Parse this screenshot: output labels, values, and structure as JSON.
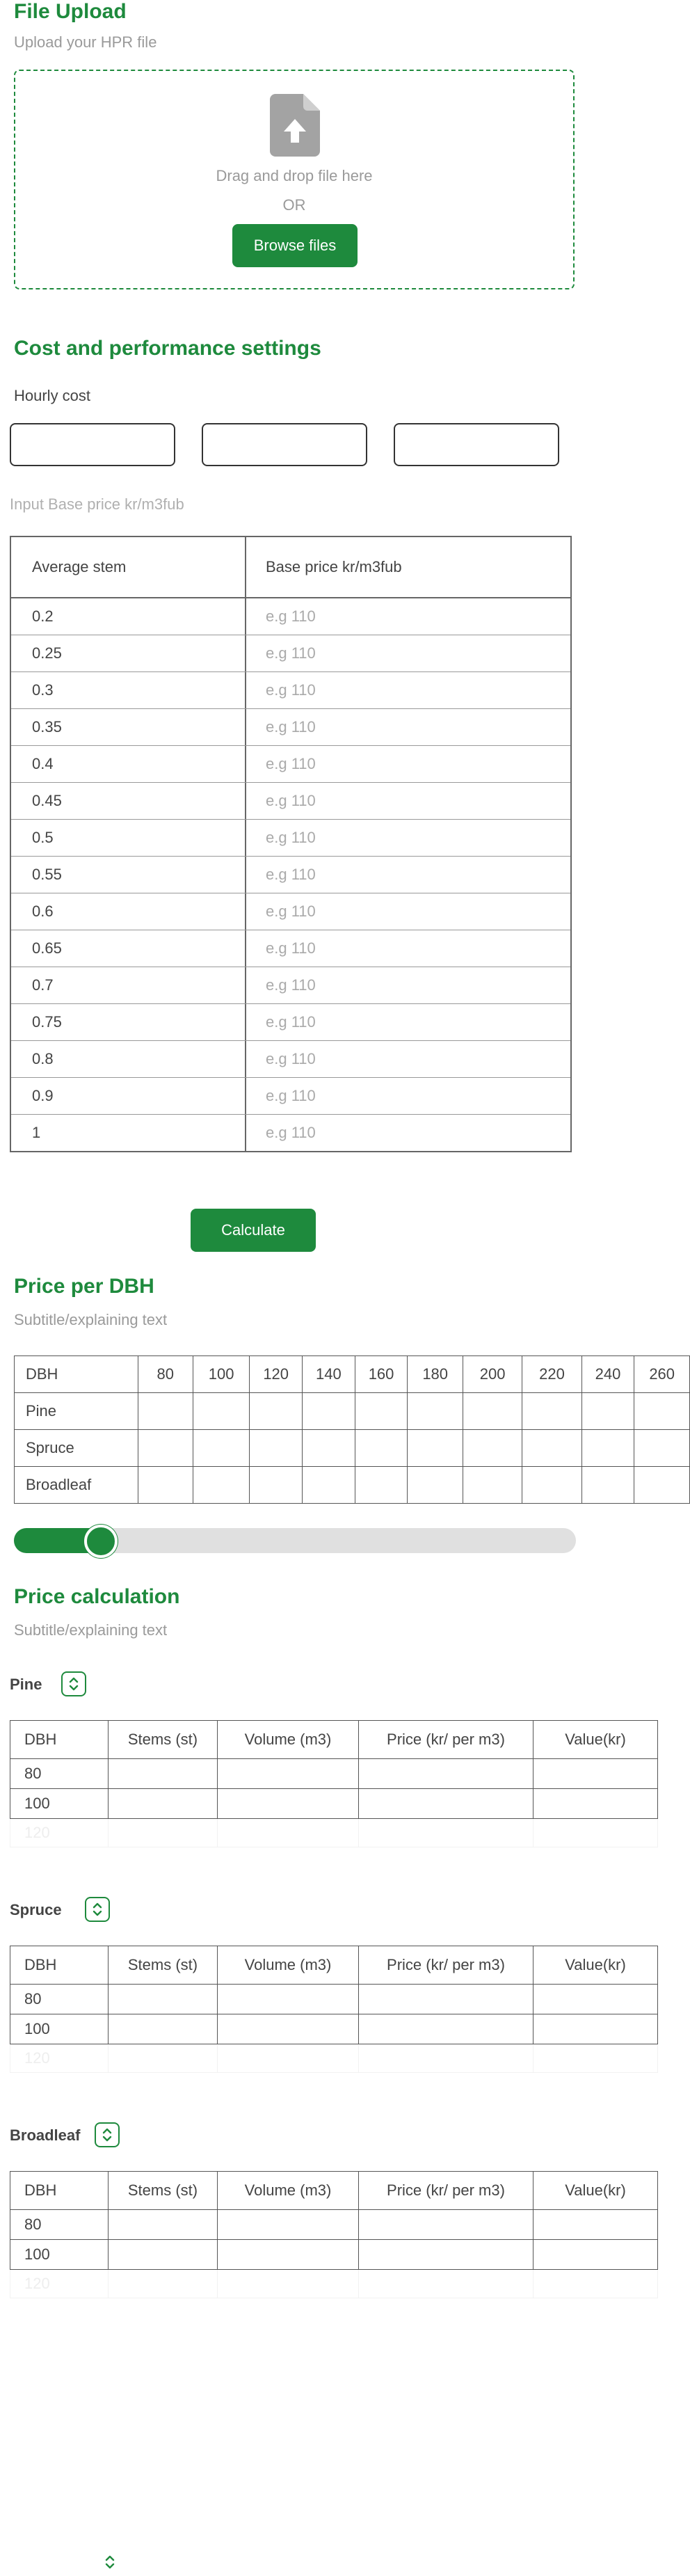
{
  "upload": {
    "title": "File Upload",
    "subtitle": "Upload your HPR file",
    "drag_text": "Drag and drop file here",
    "or_text": "OR",
    "browse_label": "Browse files"
  },
  "settings": {
    "title": "Cost and performance settings",
    "hourly_label": "Hourly cost",
    "hourly_values": [
      "",
      "",
      ""
    ],
    "base_label": "Input Base price kr/m3fub",
    "col_stem": "Average stem",
    "col_price": "Base price kr/m3fub",
    "placeholder": "e.g 110",
    "stems": [
      "0.2",
      "0.25",
      "0.3",
      "0.35",
      "0.4",
      "0.45",
      "0.5",
      "0.55",
      "0.6",
      "0.65",
      "0.7",
      "0.75",
      "0.8",
      "0.9",
      "1"
    ]
  },
  "calculate_label": "Calculate",
  "price_dbh": {
    "title": "Price per DBH",
    "subtitle": "Subtitle/explaining text",
    "col_label": "DBH",
    "columns": [
      "80",
      "100",
      "120",
      "140",
      "160",
      "180",
      "200",
      "220",
      "240",
      "260"
    ],
    "rows": [
      "Pine",
      "Spruce",
      "Broadleaf"
    ],
    "slider_value": 0.15
  },
  "price_calc": {
    "title": "Price calculation",
    "subtitle": "Subtitle/explaining text",
    "columns": [
      "DBH",
      "Stems (st)",
      "Volume (m3)",
      "Price (kr/ per m3)",
      "Value(kr)"
    ],
    "dbh_rows": [
      "80",
      "100",
      "120"
    ],
    "species": [
      "Pine",
      "Spruce",
      "Broadleaf"
    ]
  },
  "icons": {
    "upload": "file-upload-icon",
    "stepper": "chevron-up-down-icon"
  },
  "colors": {
    "accent": "#1e8a3d",
    "muted": "#9a9a9a",
    "track": "#e0e0e0"
  }
}
